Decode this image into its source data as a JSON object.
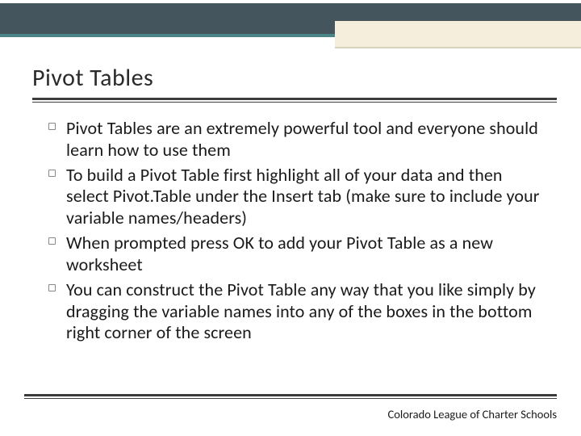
{
  "title": "Pivot Tables",
  "bullets": [
    "Pivot Tables are an extremely powerful tool and everyone should learn how to use them",
    "To build a Pivot Table first highlight all of your data and then select Pivot.Table under the Insert tab (make sure to include your variable names/headers)",
    "When prompted press OK to add your Pivot Table as a new worksheet",
    "You can construct the Pivot Table any way that you like simply by dragging the variable names into any of the boxes in the bottom right corner of the screen"
  ],
  "footer": "Colorado League of Charter Schools"
}
